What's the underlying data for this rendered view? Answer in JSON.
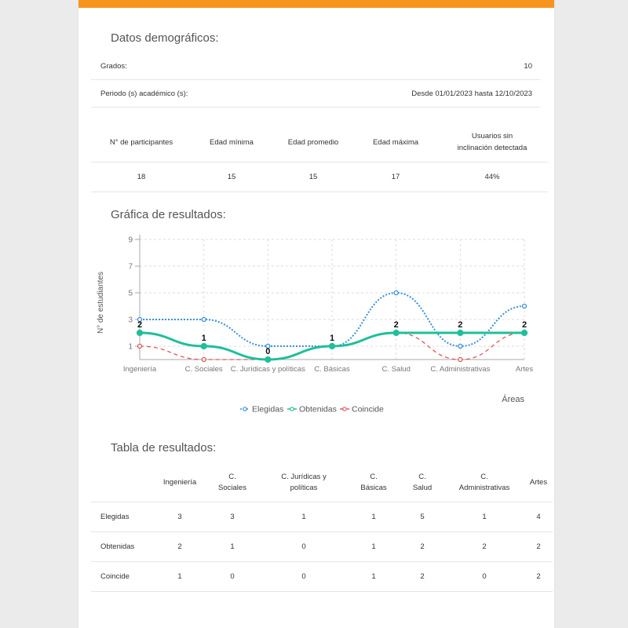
{
  "demographics": {
    "title": "Datos demográficos:",
    "grades_label": "Grados:",
    "grades_value": "10",
    "period_label": "Periodo (s) académico (s):",
    "period_value": "Desde 01/01/2023 hasta 12/10/2023"
  },
  "stats": {
    "headers": [
      "N° de participantes",
      "Edad mínima",
      "Edad promedio",
      "Edad máxima",
      "Usuarios sin\ninclinación detectada"
    ],
    "values": [
      "18",
      "15",
      "15",
      "17",
      "44%"
    ]
  },
  "chart_section_title": "Gráfica de resultados:",
  "chart_data": {
    "type": "line",
    "categories": [
      "Ingeniería",
      "C. Sociales",
      "C. Jurídicas y políticas",
      "C. Básicas",
      "C. Salud",
      "C. Administrativas",
      "Artes"
    ],
    "series": [
      {
        "name": "Elegidas",
        "values": [
          3,
          3,
          1,
          1,
          5,
          1,
          4
        ],
        "color": "#3a8fd8",
        "style": "dotted"
      },
      {
        "name": "Obtenidas",
        "values": [
          2,
          1,
          0,
          1,
          2,
          2,
          2
        ],
        "color": "#1fbf9a",
        "style": "solid"
      },
      {
        "name": "Coincide",
        "values": [
          1,
          0,
          0,
          1,
          2,
          0,
          2
        ],
        "color": "#e05a5a",
        "style": "dashed"
      }
    ],
    "data_labels_series": "Obtenidas",
    "xlabel": "Áreas",
    "ylabel": "N° de estudiantes",
    "yticks": [
      "1",
      "3",
      "5",
      "7",
      "9"
    ],
    "ylim": [
      0,
      9
    ],
    "grid": true,
    "legend_position": "bottom-center"
  },
  "results_table": {
    "title": "Tabla de resultados:",
    "headers": [
      "",
      "Ingeniería",
      "C.\nSociales",
      "C. Jurídicas y\npolíticas",
      "C.\nBásicas",
      "C.\nSalud",
      "C.\nAdministrativas",
      "Artes"
    ],
    "rows": [
      {
        "label": "Elegidas",
        "values": [
          "3",
          "3",
          "1",
          "1",
          "5",
          "1",
          "4"
        ]
      },
      {
        "label": "Obtenidas",
        "values": [
          "2",
          "1",
          "0",
          "1",
          "2",
          "2",
          "2"
        ]
      },
      {
        "label": "Coincide",
        "values": [
          "1",
          "0",
          "0",
          "1",
          "2",
          "0",
          "2"
        ]
      }
    ]
  },
  "colors": {
    "accent": "#f7941d",
    "background": "#ebebeb",
    "sheet": "#ffffff"
  }
}
